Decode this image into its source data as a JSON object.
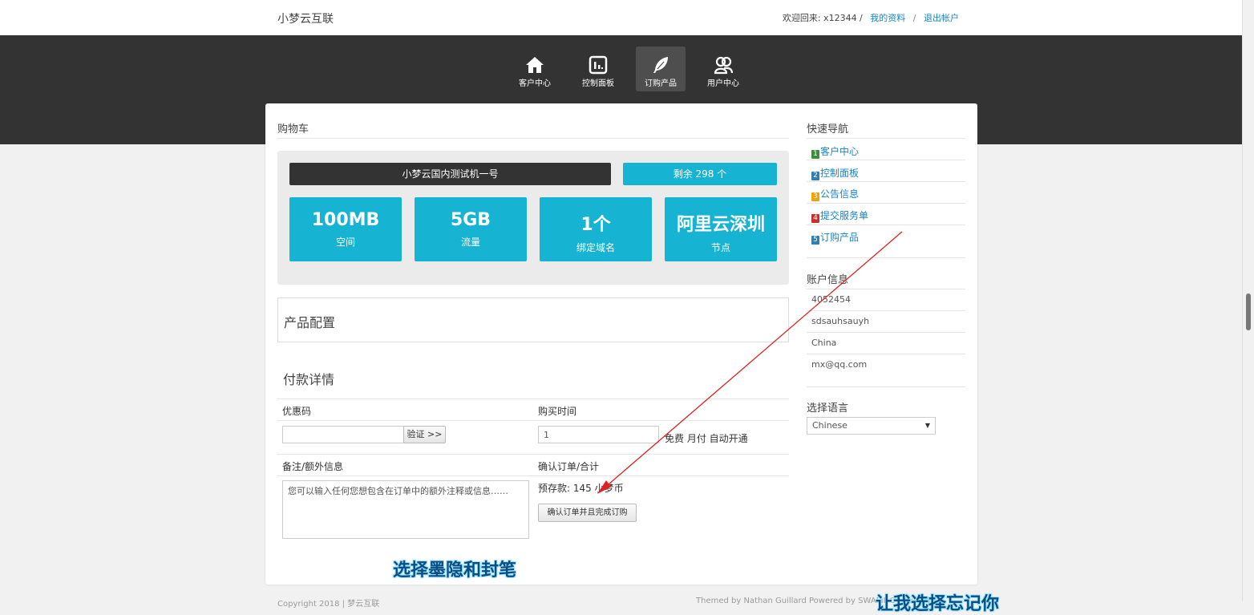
{
  "header": {
    "brand": "小梦云互联",
    "welcome": "欢迎回来: x12344 /",
    "profile_link": "我的资料",
    "separator": "/",
    "logout_link": "退出帐户"
  },
  "nav": {
    "items": [
      {
        "label": "客户中心",
        "icon": "home-icon"
      },
      {
        "label": "控制面板",
        "icon": "dashboard-icon"
      },
      {
        "label": "订购产品",
        "icon": "feather-icon",
        "active": true
      },
      {
        "label": "用户中心",
        "icon": "users-icon"
      }
    ]
  },
  "cart": {
    "title": "购物车",
    "product_name": "小梦云国内测试机一号",
    "stock": "剩余 298 个",
    "stats": [
      {
        "value": "100MB",
        "label": "空间"
      },
      {
        "value": "5GB",
        "label": "流量"
      },
      {
        "value": "1个",
        "label": "绑定域名"
      },
      {
        "value": "阿里云深圳",
        "label": "节点"
      }
    ]
  },
  "config": {
    "title": "产品配置"
  },
  "payment": {
    "title": "付款详情",
    "coupon_label": "优惠码",
    "coupon_value": "",
    "verify_button": "验证 >>",
    "period_label": "购买时间",
    "period_value": "1",
    "period_note": "免费 月付 自动开通",
    "notes_label": "备注/额外信息",
    "notes_placeholder": "您可以输入任何您想包含在订单中的额外注释或信息……",
    "confirm_label": "确认订单/合计",
    "balance": "预存款: 145 小梦币",
    "submit_button": "确认订单并且完成订购"
  },
  "sidebar": {
    "quicknav_title": "快速导航",
    "links": [
      {
        "num": "1",
        "label": "客户中心",
        "color": "#3c8d3c"
      },
      {
        "num": "2",
        "label": "控制面板",
        "color": "#2d7fb5"
      },
      {
        "num": "3",
        "label": "公告信息",
        "color": "#f0a30a"
      },
      {
        "num": "4",
        "label": "提交服务单",
        "color": "#c9302c"
      },
      {
        "num": "5",
        "label": "订购产品",
        "color": "#2d7fb5"
      }
    ],
    "account_title": "账户信息",
    "account": [
      "4052454",
      "sdsauhsauyh",
      "China",
      "mx@qq.com"
    ],
    "language_title": "选择语言",
    "language_value": "Chinese"
  },
  "captions": {
    "line1": "选择墨隐和封笔",
    "line2": "让我选择忘记你"
  },
  "footer": {
    "left": "Copyright 2018 | 梦云互联",
    "right": "Themed by Nathan Guillard Powered by SWAPIDC | Support"
  },
  "colors": {
    "accent": "#16b3d2",
    "dark": "#333333",
    "link": "#1a84c6"
  }
}
